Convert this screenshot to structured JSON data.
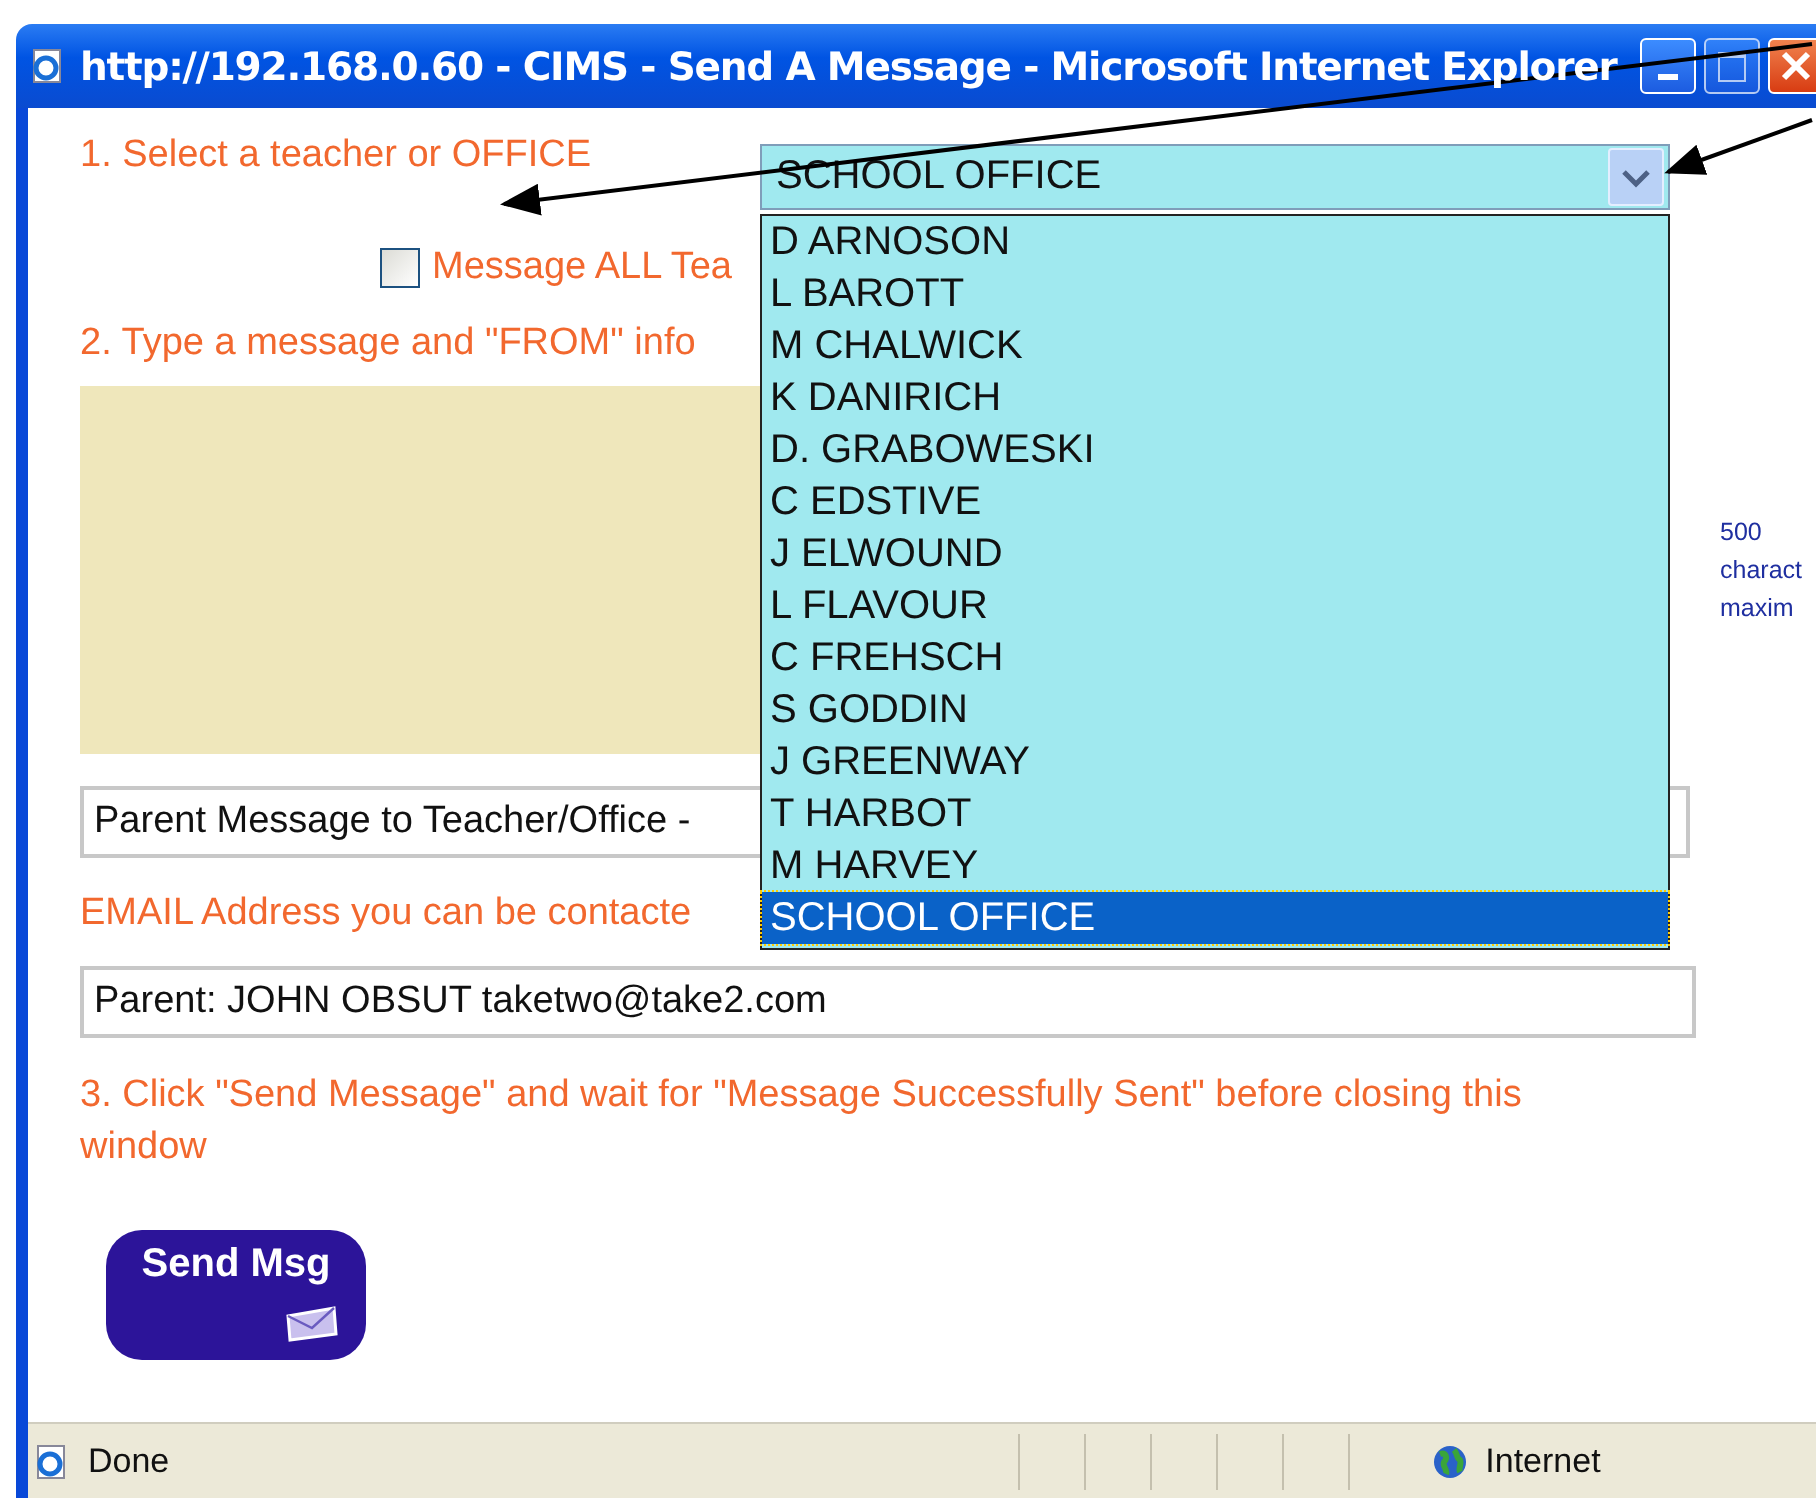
{
  "window": {
    "title": "http://192.168.0.60 - CIMS - Send A Message - Microsoft Internet Explorer"
  },
  "form": {
    "step1_label": "1. Select a teacher or OFFICE",
    "select_value": "SCHOOL OFFICE",
    "all_teachers": {
      "label": "Message ALL Tea",
      "checked": false
    },
    "step2_label": "2. Type a message and \"FROM\" info",
    "char_limit": [
      "500",
      "charact",
      "maxim"
    ],
    "subject_value": "Parent Message to Teacher/Office -",
    "email_label": "EMAIL Address you can be contacte",
    "from_value": "Parent: JOHN OBSUT taketwo@take2.com",
    "step3_label": "3. Click \"Send Message\" and wait for \"Message Successfully Sent\" before closing this window",
    "send_button": "Send Msg"
  },
  "dropdown": {
    "options": [
      {
        "label": "D ARNOSON",
        "selected": false
      },
      {
        "label": "L BAROTT",
        "selected": false
      },
      {
        "label": "M CHALWICK",
        "selected": false
      },
      {
        "label": "K DANIRICH",
        "selected": false
      },
      {
        "label": "D. GRABOWESKI",
        "selected": false
      },
      {
        "label": "C EDSTIVE",
        "selected": false
      },
      {
        "label": "J ELWOUND",
        "selected": false
      },
      {
        "label": "L FLAVOUR",
        "selected": false
      },
      {
        "label": "C FREHSCH",
        "selected": false
      },
      {
        "label": "S GODDIN",
        "selected": false
      },
      {
        "label": "J GREENWAY",
        "selected": false
      },
      {
        "label": "T HARBOT",
        "selected": false
      },
      {
        "label": "M HARVEY",
        "selected": false
      },
      {
        "label": "SCHOOL OFFICE",
        "selected": true
      }
    ]
  },
  "status_bar": {
    "text": "Done",
    "zone": "Internet"
  }
}
